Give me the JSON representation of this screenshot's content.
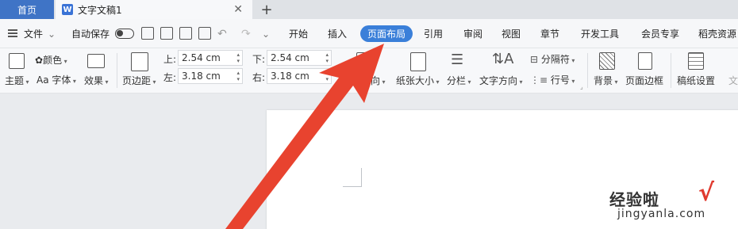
{
  "tabs": {
    "home": "首页",
    "doc_icon": "W",
    "doc_title": "文字文稿1",
    "close": "✕",
    "add": "+"
  },
  "menubar": {
    "file": "文件",
    "autosave": "自动保存",
    "items": [
      "开始",
      "插入",
      "页面布局",
      "引用",
      "审阅",
      "视图",
      "章节",
      "开发工具",
      "会员专享",
      "稻壳资源"
    ],
    "active": "页面布局"
  },
  "ribbon": {
    "theme": "主题",
    "color": "颜色",
    "font": "Aa 字体",
    "effect": "效果",
    "margin": "页边距",
    "top_label": "上:",
    "top_value": "2.54 cm",
    "bottom_label": "下:",
    "bottom_value": "2.54 cm",
    "left_label": "左:",
    "left_value": "3.18 cm",
    "right_label": "右:",
    "right_value": "3.18 cm",
    "orientation": "向",
    "paper_size": "纸张大小",
    "columns": "分栏",
    "text_direction": "文字方向",
    "separator": "分隔符",
    "line_number": "行号",
    "background": "背景",
    "page_border": "页面边框",
    "manuscript": "稿纸设置",
    "cut_off": "文"
  },
  "watermark": {
    "text": "经验啦",
    "check": "√",
    "url": "jingyanla.com"
  },
  "colors": {
    "accent": "#3a7fd9",
    "home_tab": "#3f74c6",
    "arrow": "#e8432f"
  }
}
